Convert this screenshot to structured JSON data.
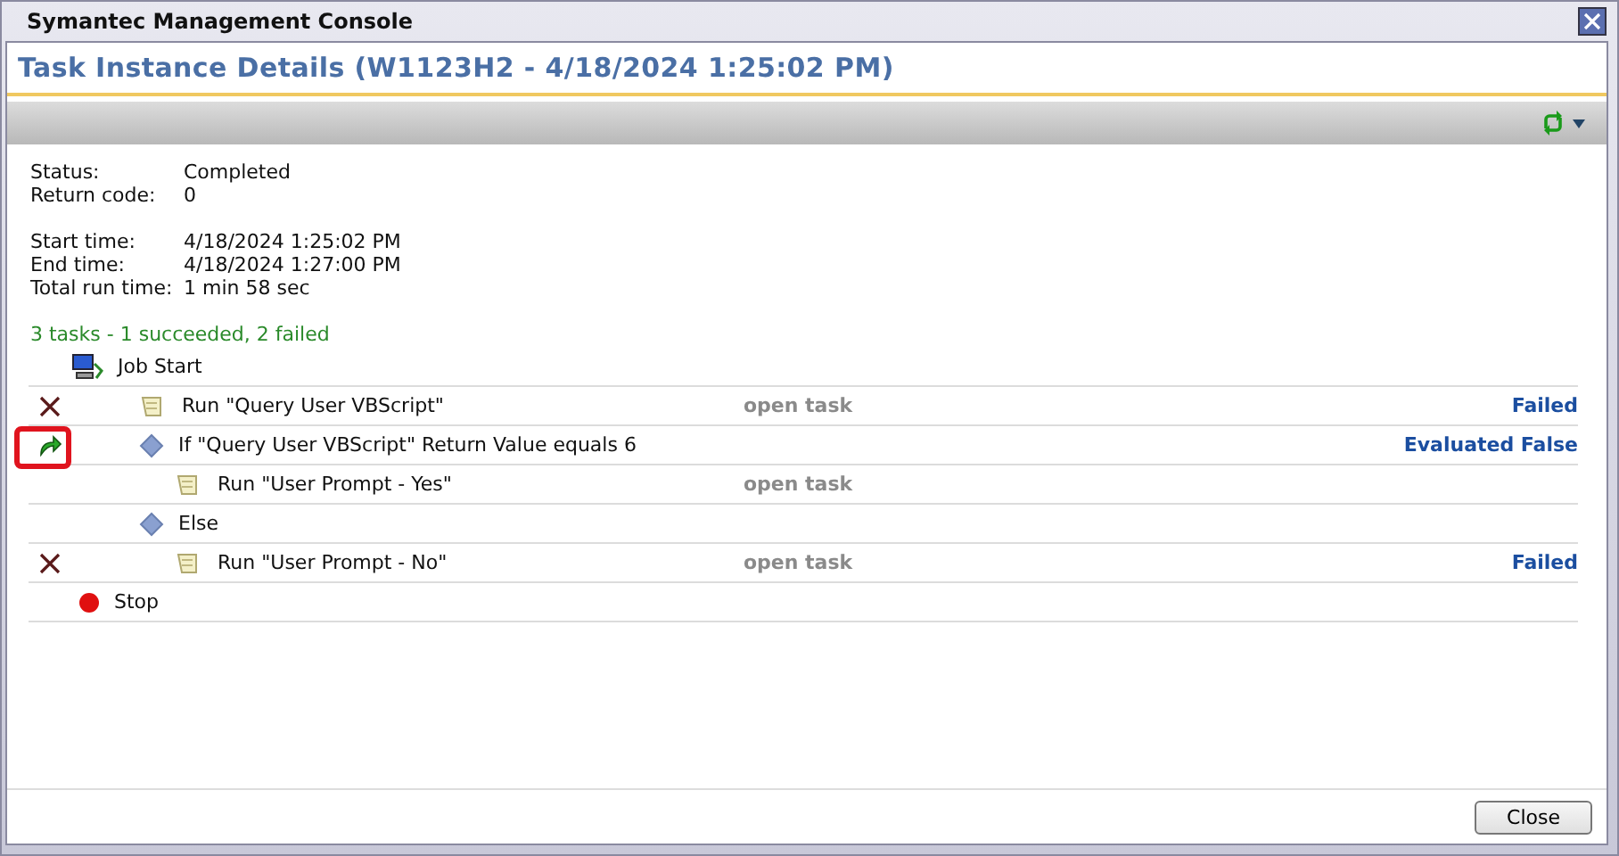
{
  "window": {
    "title": "Symantec Management Console"
  },
  "header": {
    "title": "Task Instance Details (W1123H2 - 4/18/2024 1:25:02 PM)"
  },
  "details": [
    [
      {
        "label": "Status:",
        "value": "Completed"
      },
      {
        "label": "Return code:",
        "value": "0"
      }
    ],
    [
      {
        "label": "Start time:",
        "value": "4/18/2024 1:25:02 PM"
      },
      {
        "label": "End time:",
        "value": "4/18/2024 1:27:00 PM"
      },
      {
        "label": "Total run time:",
        "value": "1 min 58 sec"
      }
    ]
  ],
  "summary": "3 tasks - 1 succeeded, 2 failed",
  "steps": [
    {
      "kind": "start",
      "label": "Job Start",
      "children": [
        {
          "kind": "task",
          "label": "Run \"Query User VBScript\"",
          "failed": true,
          "link": "open task",
          "result": "Failed"
        },
        {
          "kind": "condition",
          "label": "If \"Query User VBScript\" Return Value equals 6",
          "branched": true,
          "highlighted": true,
          "result": "Evaluated False",
          "children": [
            {
              "kind": "task",
              "label": "Run \"User Prompt - Yes\"",
              "link": "open task"
            }
          ]
        },
        {
          "kind": "condition",
          "label": "Else",
          "children": [
            {
              "kind": "task",
              "label": "Run \"User Prompt - No\"",
              "failed": true,
              "link": "open task",
              "result": "Failed"
            }
          ]
        }
      ]
    },
    {
      "kind": "stop",
      "label": "Stop"
    }
  ],
  "buttons": [
    "Close"
  ]
}
